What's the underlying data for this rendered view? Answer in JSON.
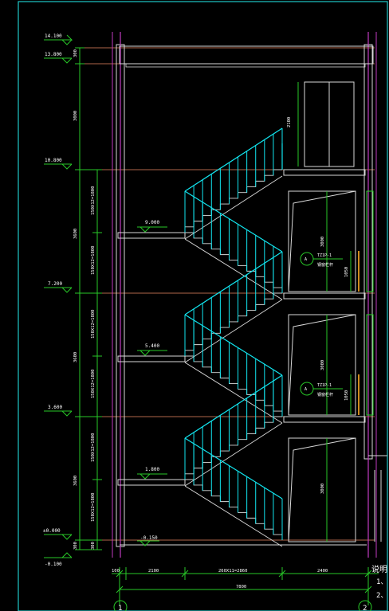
{
  "colors": {
    "background": "#000000",
    "frame": "#1ec8c8",
    "wall": "#d9d9d9",
    "column": "#c03cc0",
    "floor_line": "#b0664a",
    "railing": "#12e6f0",
    "dimension": "#28c828",
    "text": "#ffffff",
    "door": "#28d028"
  },
  "elevations": {
    "top": "14.100",
    "roof": "13.800",
    "level_3": "10.800",
    "level_2": "7.200",
    "level_1": "3.600",
    "ground": "±0.000",
    "outside": "-0.100",
    "landing_3": "9.000",
    "landing_2": "5.400",
    "landing_1": "1.800",
    "pit": "-0.150"
  },
  "left_dimensions": {
    "parapet": "300",
    "top_floor": "3000",
    "flight_6": "150X12=1800",
    "flight_5": "150X12=1800",
    "storey_3": "3600",
    "flight_4": "150X12=1800",
    "flight_3": "150X12=1800",
    "storey_2": "3600",
    "flight_2": "150X12=1800",
    "flight_1": "150X12=1800",
    "storey_1": "3600",
    "base": "300"
  },
  "inner_dimensions": {
    "door_top": "2100",
    "door_mid": "3000",
    "door_low": "3000",
    "rail_h1": "1050",
    "rail_h2": "1050"
  },
  "window_tags": [
    {
      "code": "TZ1P-1",
      "note": "钢窗栏杆",
      "mark": "A"
    },
    {
      "code": "TZ1P-1",
      "note": "钢窗栏杆",
      "mark": "A"
    }
  ],
  "bottom_dimensions": {
    "wall": "100",
    "landing": "2100",
    "run": "260X11=2860",
    "rest": "2400",
    "total": "7800"
  },
  "axes": [
    "1",
    "2"
  ],
  "notes": {
    "title": "说明",
    "line1": "1、",
    "line2": "2、"
  }
}
